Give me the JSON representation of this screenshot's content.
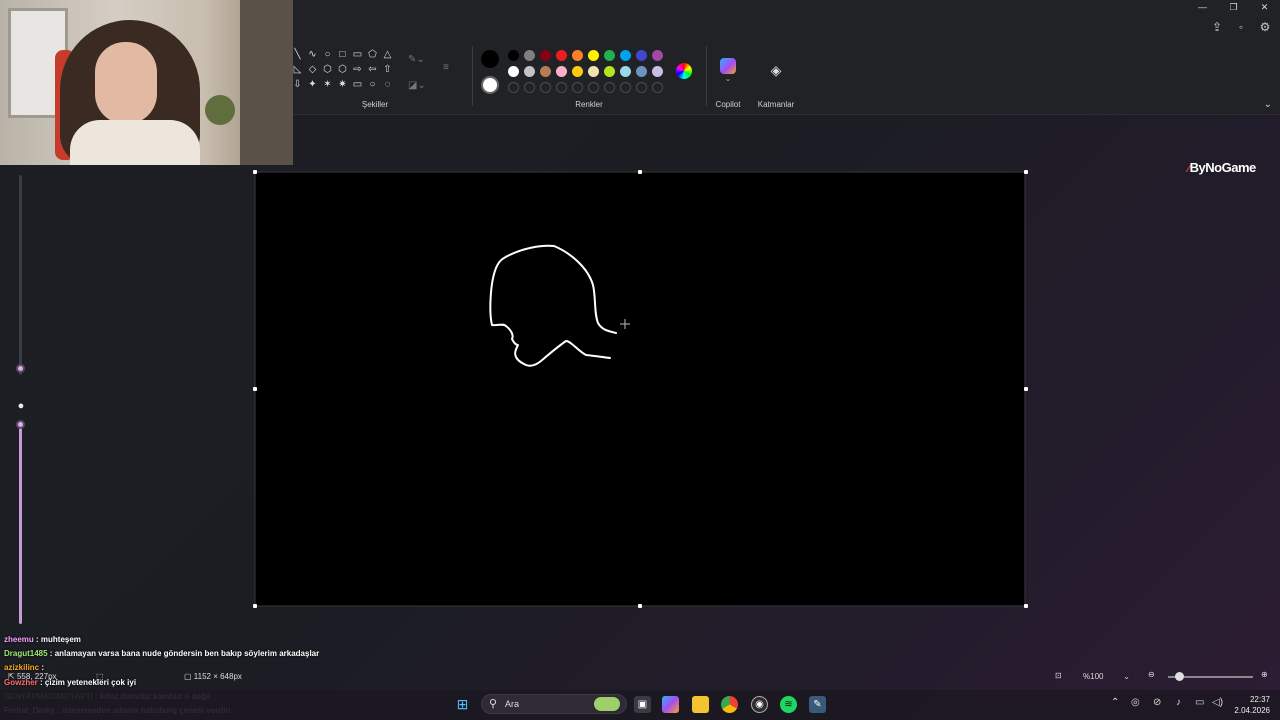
{
  "ribbon": {
    "groups": {
      "shapes": "Şekiller",
      "colors": "Renkler",
      "copilot": "Copilot",
      "layers": "Katmanlar"
    },
    "shape_glyphs": [
      "╲",
      "∿",
      "○",
      "□",
      "▭",
      "⬠",
      "△",
      "◺",
      "◇",
      "⬡",
      "⬡",
      "⇨",
      "⇦",
      "⇧",
      "⇩",
      "✦",
      "✶",
      "✷",
      "▭",
      "○",
      "◌"
    ],
    "primary_color": "#000000",
    "secondary_color": "#ffffff",
    "palette_row1": [
      "#000000",
      "#7f7f7f",
      "#880015",
      "#ed1c24",
      "#ff7f27",
      "#fff200",
      "#22b14c",
      "#00a2e8",
      "#3f48cc",
      "#a349a4"
    ],
    "palette_row2": [
      "#ffffff",
      "#c3c3c3",
      "#b97a57",
      "#ffaec9",
      "#ffc90e",
      "#efe4b0",
      "#b5e61d",
      "#99d9ea",
      "#7092be",
      "#c8bfe7"
    ]
  },
  "watermark": {
    "brand": "ByNoGame"
  },
  "chat": [
    {
      "user": "zheemu",
      "message": "muhteşem",
      "color": "#f4a0ff"
    },
    {
      "user": "Dragut1485",
      "message": "anlamayan varsa bana nude göndersin ben bakıp söylerim arkadaşlar",
      "color": "#9fe870"
    },
    {
      "user": "azizkilinc",
      "message": "",
      "color": "#f5a623"
    },
    {
      "user": "Gowzher",
      "message": "çizim yetenekleri çok iyi",
      "color": "#ff6a6a"
    },
    {
      "user": "BENYAPMADIMOYAPTI",
      "message": "kifoz dümdüz kambur o değil",
      "color": "#7cf27c"
    },
    {
      "user": "Ferhat_Dmky",
      "message": "istenemeden adama habsburg çenesi verdin",
      "color": "#ffffff"
    }
  ],
  "status": {
    "cursor_pos": "558, 227px",
    "canvas_size": "1152 × 648px",
    "zoom": "%100"
  },
  "taskbar": {
    "search_placeholder": "Ara",
    "time": "22:37",
    "date": "2.04.2026"
  }
}
